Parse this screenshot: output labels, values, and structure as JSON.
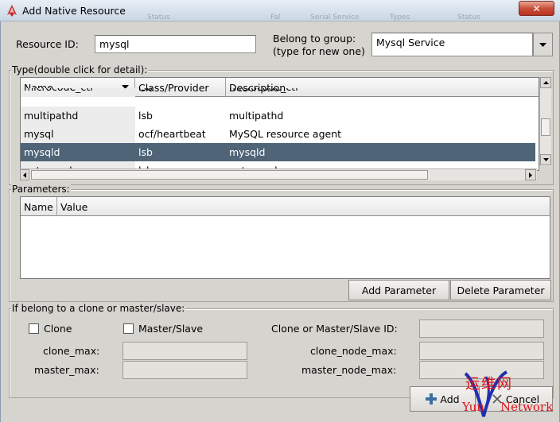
{
  "window": {
    "title": "Add Native Resource",
    "close_glyph": "✕",
    "ghost_texts": [
      "Status",
      "Fal",
      "Serial Service",
      "Types",
      "Status"
    ]
  },
  "form": {
    "resource_id_label": "Resource ID:",
    "resource_id_value": "mysql",
    "group_label_line1": "Belong to group:",
    "group_label_line2": "(type for new one)",
    "group_value": "Mysql Service"
  },
  "type_section": {
    "title": "Type(double click for detail):",
    "columns": [
      "Name",
      "Class/Provider",
      "Description"
    ],
    "rows": [
      {
        "name": "multipathd",
        "provider": "lsb",
        "description": "multipathd"
      },
      {
        "name": "mysql",
        "provider": "ocf/heartbeat",
        "description": "MySQL resource agent"
      },
      {
        "name": "mysqld",
        "provider": "lsb",
        "description": "mysqld"
      }
    ],
    "partial_top_row": {
      "name": "microcode_ctl",
      "provider": "lsb",
      "description": "microcode_ctl"
    },
    "partial_bottom_row": {
      "name": "netconsole",
      "provider": "lsb",
      "description": "netconsole"
    },
    "selected_index": 2
  },
  "parameters_section": {
    "title": "Parameters:",
    "columns": [
      "Name",
      "Value"
    ],
    "add_button": "Add Parameter",
    "delete_button": "Delete Parameter"
  },
  "clone_section": {
    "title": "If belong to a clone or master/slave:",
    "clone_checkbox": "Clone",
    "master_slave_checkbox": "Master/Slave",
    "id_label": "Clone or Master/Slave ID:",
    "clone_max_label": "clone_max:",
    "master_max_label": "master_max:",
    "clone_node_max_label": "clone_node_max:",
    "master_node_max_label": "master_node_max:"
  },
  "footer": {
    "add_button": "Add",
    "cancel_button": "Cancel"
  },
  "watermark": {
    "chinese": "运维网",
    "latin_left": "Yun",
    "latin_right": "Network"
  },
  "colors": {
    "selection": "#4f6477",
    "close_button": "#c9503a",
    "watermark": "#e0141e"
  },
  "icons": [
    "heartbeat-app-icon",
    "close-icon",
    "combo-arrow-icon",
    "sort-arrow-icon",
    "scroll-up-icon",
    "scroll-down-icon",
    "scroll-left-icon",
    "scroll-right-icon",
    "add-plus-icon",
    "cancel-icon"
  ]
}
